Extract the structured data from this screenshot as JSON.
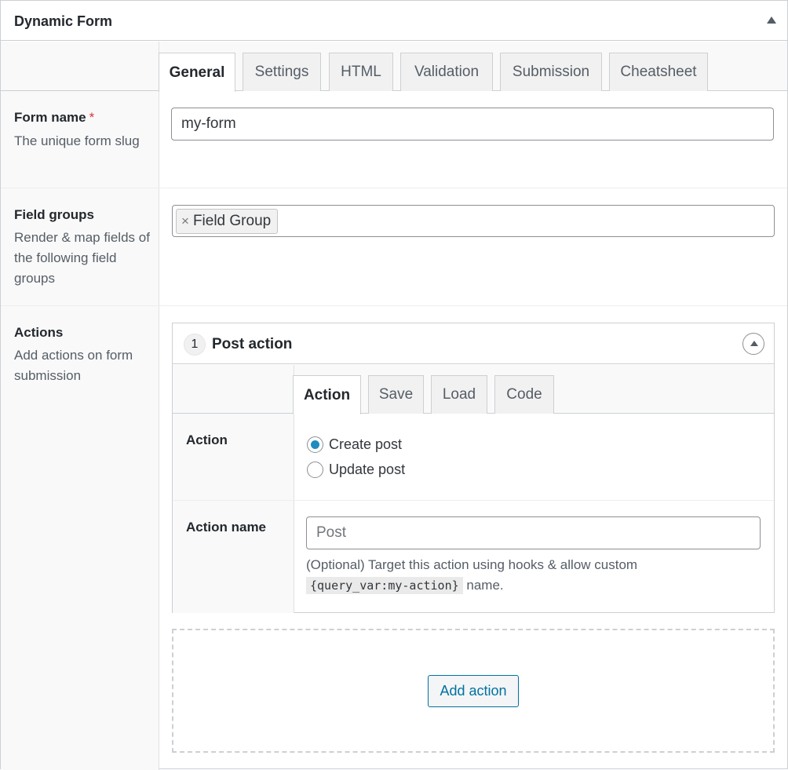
{
  "panel": {
    "title": "Dynamic Form"
  },
  "tabs": [
    {
      "label": "General"
    },
    {
      "label": "Settings"
    },
    {
      "label": "HTML"
    },
    {
      "label": "Validation"
    },
    {
      "label": "Submission"
    },
    {
      "label": "Cheatsheet"
    }
  ],
  "active_tab": "General",
  "fields": {
    "form_name": {
      "label": "Form name",
      "required_mark": "*",
      "description": "The unique form slug",
      "value": "my-form"
    },
    "field_groups": {
      "label": "Field groups",
      "description": "Render & map fields of the following field groups",
      "chips": [
        {
          "remove": "×",
          "label": "Field Group"
        }
      ]
    },
    "actions": {
      "label": "Actions",
      "description": "Add actions on form submission"
    }
  },
  "action_layout": {
    "number": "1",
    "title": "Post action",
    "tabs": [
      {
        "label": "Action"
      },
      {
        "label": "Save"
      },
      {
        "label": "Load"
      },
      {
        "label": "Code"
      }
    ],
    "active_tab": "Action",
    "action": {
      "label": "Action",
      "options": [
        {
          "label": "Create post",
          "checked": true
        },
        {
          "label": "Update post",
          "checked": false
        }
      ]
    },
    "action_name": {
      "label": "Action name",
      "placeholder": "Post",
      "help_before": "(Optional) Target this action using hooks & allow custom",
      "help_code": "{query_var:my-action}",
      "help_after": "name."
    }
  },
  "add_action": {
    "label": "Add action"
  },
  "colors": {
    "accent": "#0071a1",
    "radio_checked": "#1e8cbe",
    "required": "#dc3232"
  }
}
